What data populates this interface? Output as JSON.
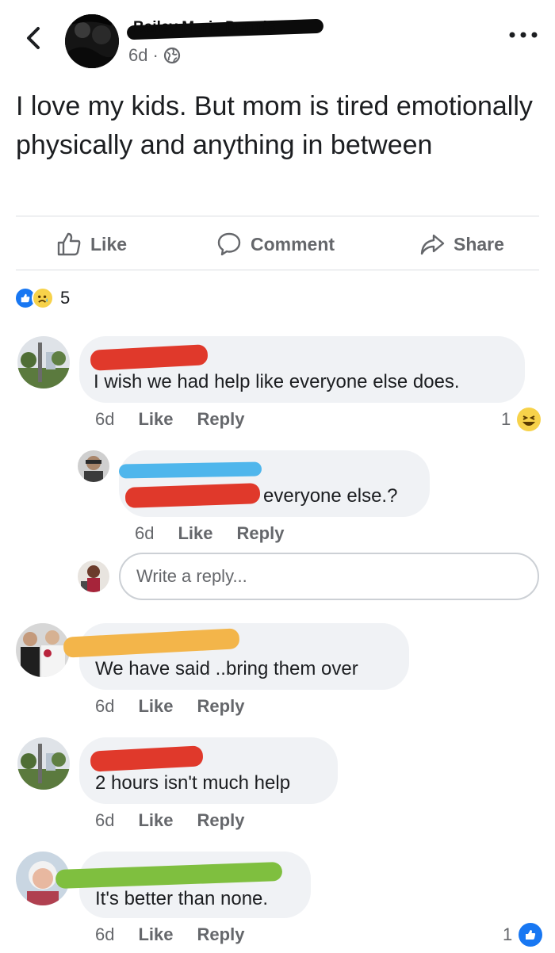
{
  "header": {
    "poster_name": "Bailey Marie Dennis",
    "time": "6d",
    "separator": "·"
  },
  "post": {
    "text": "I love my kids. But mom is tired emotionally physically and anything in between"
  },
  "actions": {
    "like": "Like",
    "comment": "Comment",
    "share": "Share"
  },
  "reactions": {
    "count": "5"
  },
  "comments": [
    {
      "text": "I wish we had help like everyone else does.",
      "time": "6d",
      "like": "Like",
      "reply": "Reply",
      "reaction_count": "1"
    },
    {
      "text": "everyone else.?",
      "time": "6d",
      "like": "Like",
      "reply": "Reply"
    },
    {
      "text": "We have said ..bring them over",
      "time": "6d",
      "like": "Like",
      "reply": "Reply"
    },
    {
      "text": "2 hours isn't much help",
      "time": "6d",
      "like": "Like",
      "reply": "Reply"
    },
    {
      "text": "It's better than none.",
      "time": "6d",
      "like": "Like",
      "reply": "Reply",
      "reaction_count": "1"
    }
  ],
  "reply_input": {
    "placeholder": "Write a reply..."
  },
  "colors": {
    "redact_black": "#0b0b0b",
    "redact_red": "#e0392b",
    "redact_blue": "#4fb6ec",
    "redact_orange": "#f3b54a",
    "redact_green": "#7fbf3f",
    "brand_blue": "#1877f2"
  }
}
